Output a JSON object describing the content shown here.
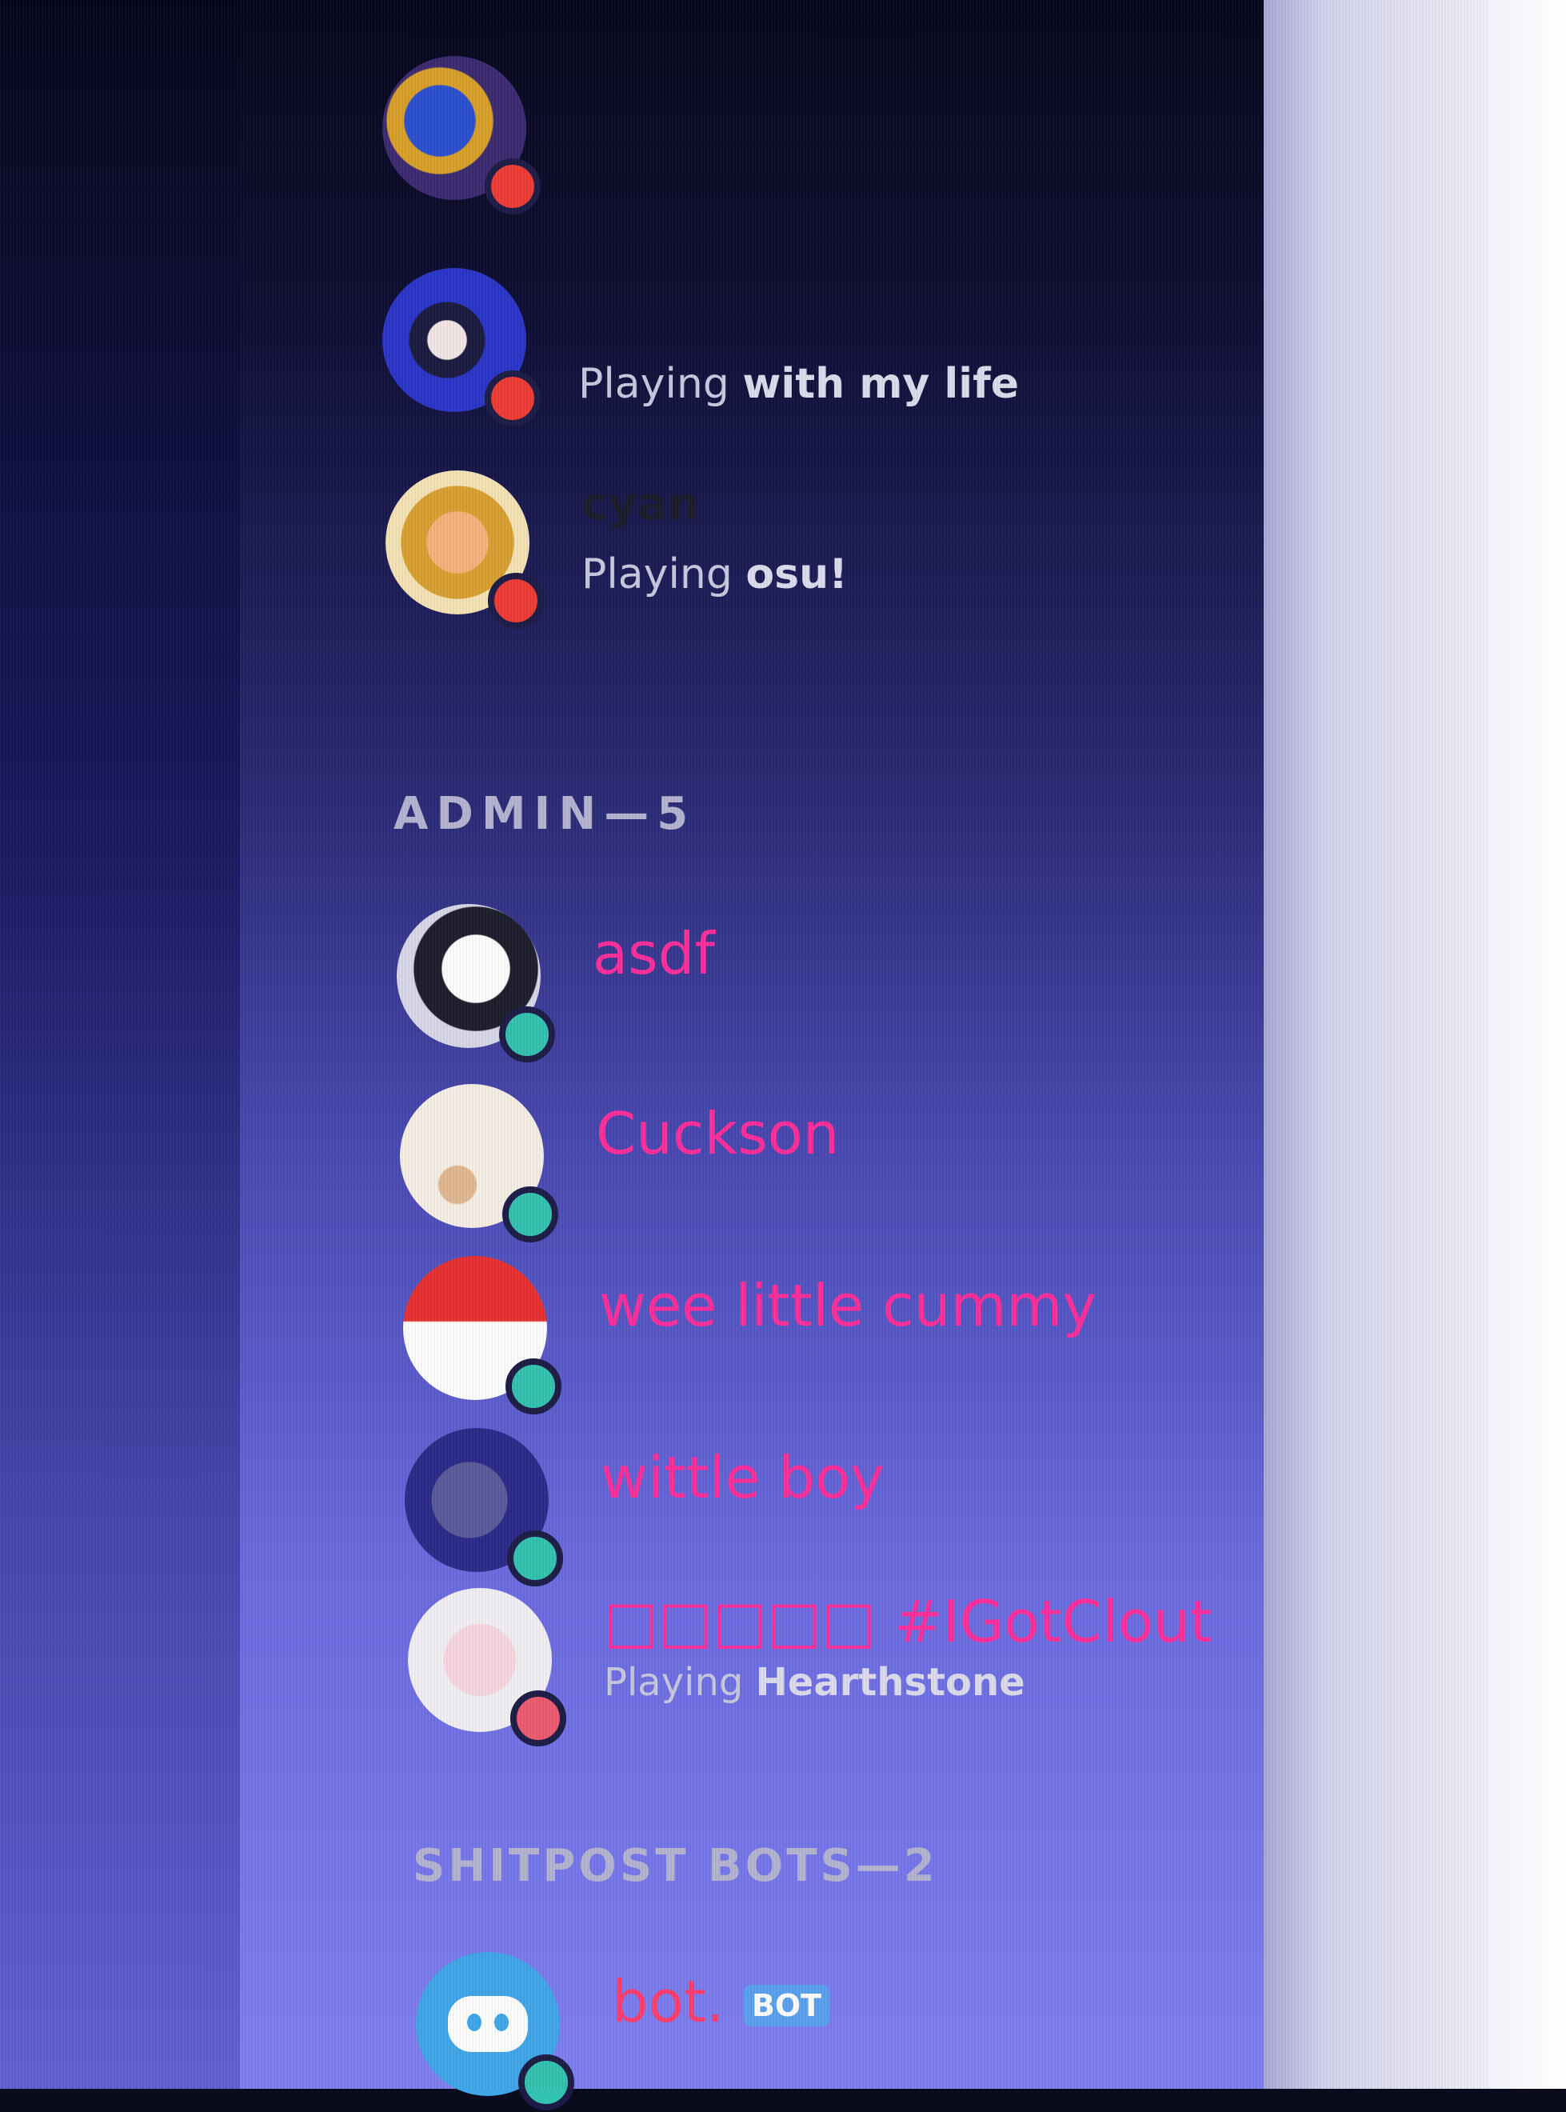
{
  "members_above": [
    {
      "name": "",
      "activity_prefix": "",
      "activity_game": "",
      "avatar": "avatar-anime-blue",
      "status": "dnd"
    },
    {
      "name": "",
      "activity_prefix": "Playing",
      "activity_game": "with my life",
      "avatar": "avatar-anime-girl",
      "status": "dnd"
    },
    {
      "name": "cyan",
      "activity_prefix": "Playing",
      "activity_game": "osu!",
      "avatar": "avatar-anime-orange",
      "status": "dnd"
    }
  ],
  "sections": [
    {
      "title": "ADMIN—5",
      "members": [
        {
          "name": "asdf",
          "activity_prefix": "",
          "activity_game": "",
          "status": "online"
        },
        {
          "name": "Cuckson",
          "activity_prefix": "",
          "activity_game": "",
          "status": "online"
        },
        {
          "name": "wee little cummy",
          "activity_prefix": "",
          "activity_game": "",
          "status": "online"
        },
        {
          "name": "wittle boy",
          "activity_prefix": "",
          "activity_game": "",
          "status": "online"
        },
        {
          "name": "□□□□□ #IGotClout",
          "activity_prefix": "Playing",
          "activity_game": "Hearthstone",
          "status": "dnd"
        }
      ]
    },
    {
      "title": "SHITPOST BOTS—2",
      "members": [
        {
          "name": "bot.",
          "tag": "BOT",
          "status": "online"
        }
      ]
    }
  ],
  "colors": {
    "admin_name": "#ff2d9b",
    "bot_name": "#ff3c6e",
    "dnd": "#ee3b34",
    "online": "#33c2b0",
    "bot_tag": "#5aa0f0"
  }
}
